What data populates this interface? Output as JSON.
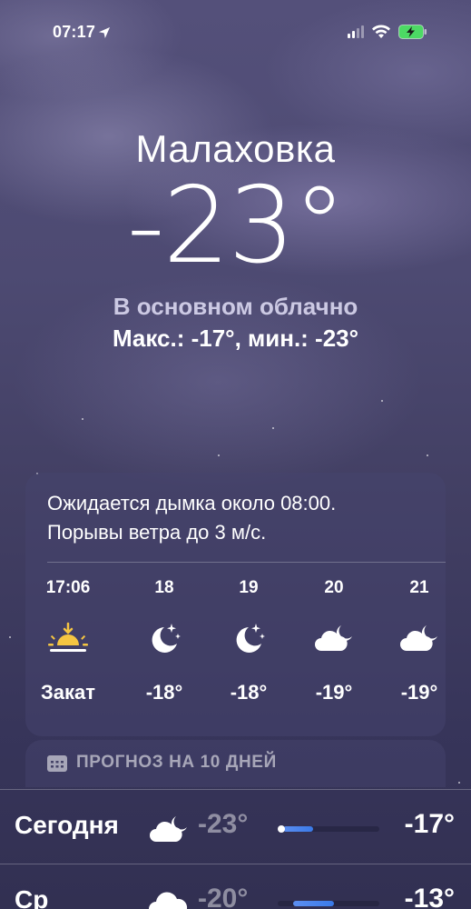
{
  "status_bar": {
    "time": "07:17",
    "icons": [
      "location-arrow-icon",
      "cellular-signal-icon",
      "wifi-icon",
      "battery-charging-icon"
    ],
    "battery_color": "#4cd964"
  },
  "location": {
    "city": "Малаховка",
    "temperature": "-23°",
    "condition": "В основном облачно",
    "hi_lo": "Макс.: -17°, мин.: -23°"
  },
  "hourly": {
    "summary_line1": "Ожидается дымка около 08:00.",
    "summary_line2": "Порывы ветра до 3 м/с.",
    "items": [
      {
        "time": "17:06",
        "icon": "sunset-icon",
        "temp": "Закат"
      },
      {
        "time": "18",
        "icon": "moon-stars-icon",
        "temp": "-18°"
      },
      {
        "time": "19",
        "icon": "moon-stars-icon",
        "temp": "-18°"
      },
      {
        "time": "20",
        "icon": "cloud-moon-icon",
        "temp": "-19°"
      },
      {
        "time": "21",
        "icon": "cloud-moon-icon",
        "temp": "-19°"
      }
    ]
  },
  "ten_day": {
    "title": "ПРОГНОЗ НА 10 ДНЕЙ",
    "days": [
      {
        "name": "Сегодня",
        "icon": "cloud-moon-icon",
        "low": "-23°",
        "high": "-17°",
        "range_start": 0.05,
        "range_end": 0.35,
        "current_dot": 0.0
      },
      {
        "name": "Ср",
        "icon": "cloud-icon",
        "low": "-20°",
        "high": "-13°",
        "range_start": 0.15,
        "range_end": 0.55
      }
    ]
  },
  "colors": {
    "accent_bar": "#3a7ae8",
    "sunset_yellow": "#f5c542"
  }
}
